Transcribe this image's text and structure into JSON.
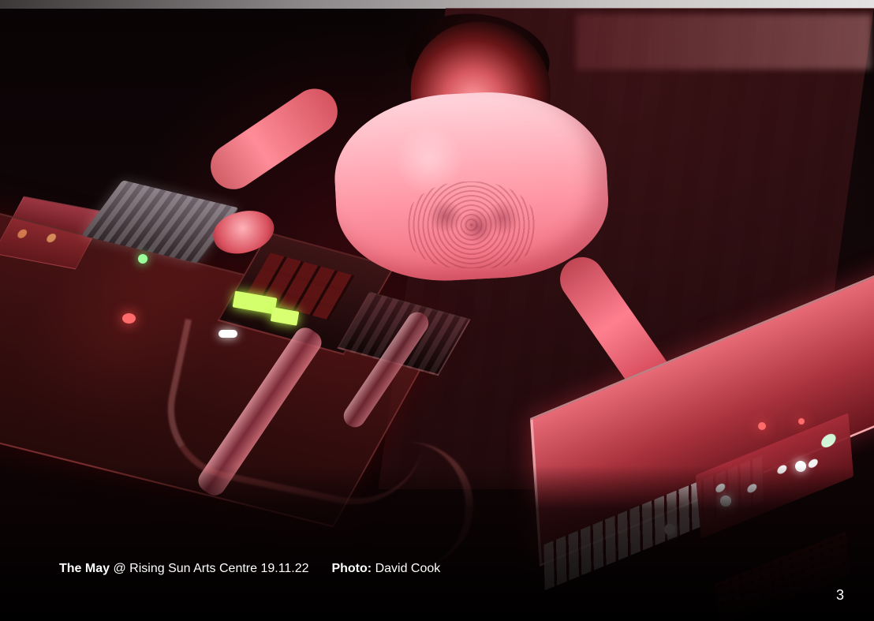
{
  "caption": {
    "title": "The May",
    "venue_text": "@ Rising Sun Arts Centre 19.11.22",
    "photo_label": "Photo:",
    "photographer": "David Cook"
  },
  "page": {
    "number": "3"
  },
  "colors": {
    "caption_text": "#ffffff",
    "stage_red": "#ff3f4f",
    "background": "#000000"
  }
}
